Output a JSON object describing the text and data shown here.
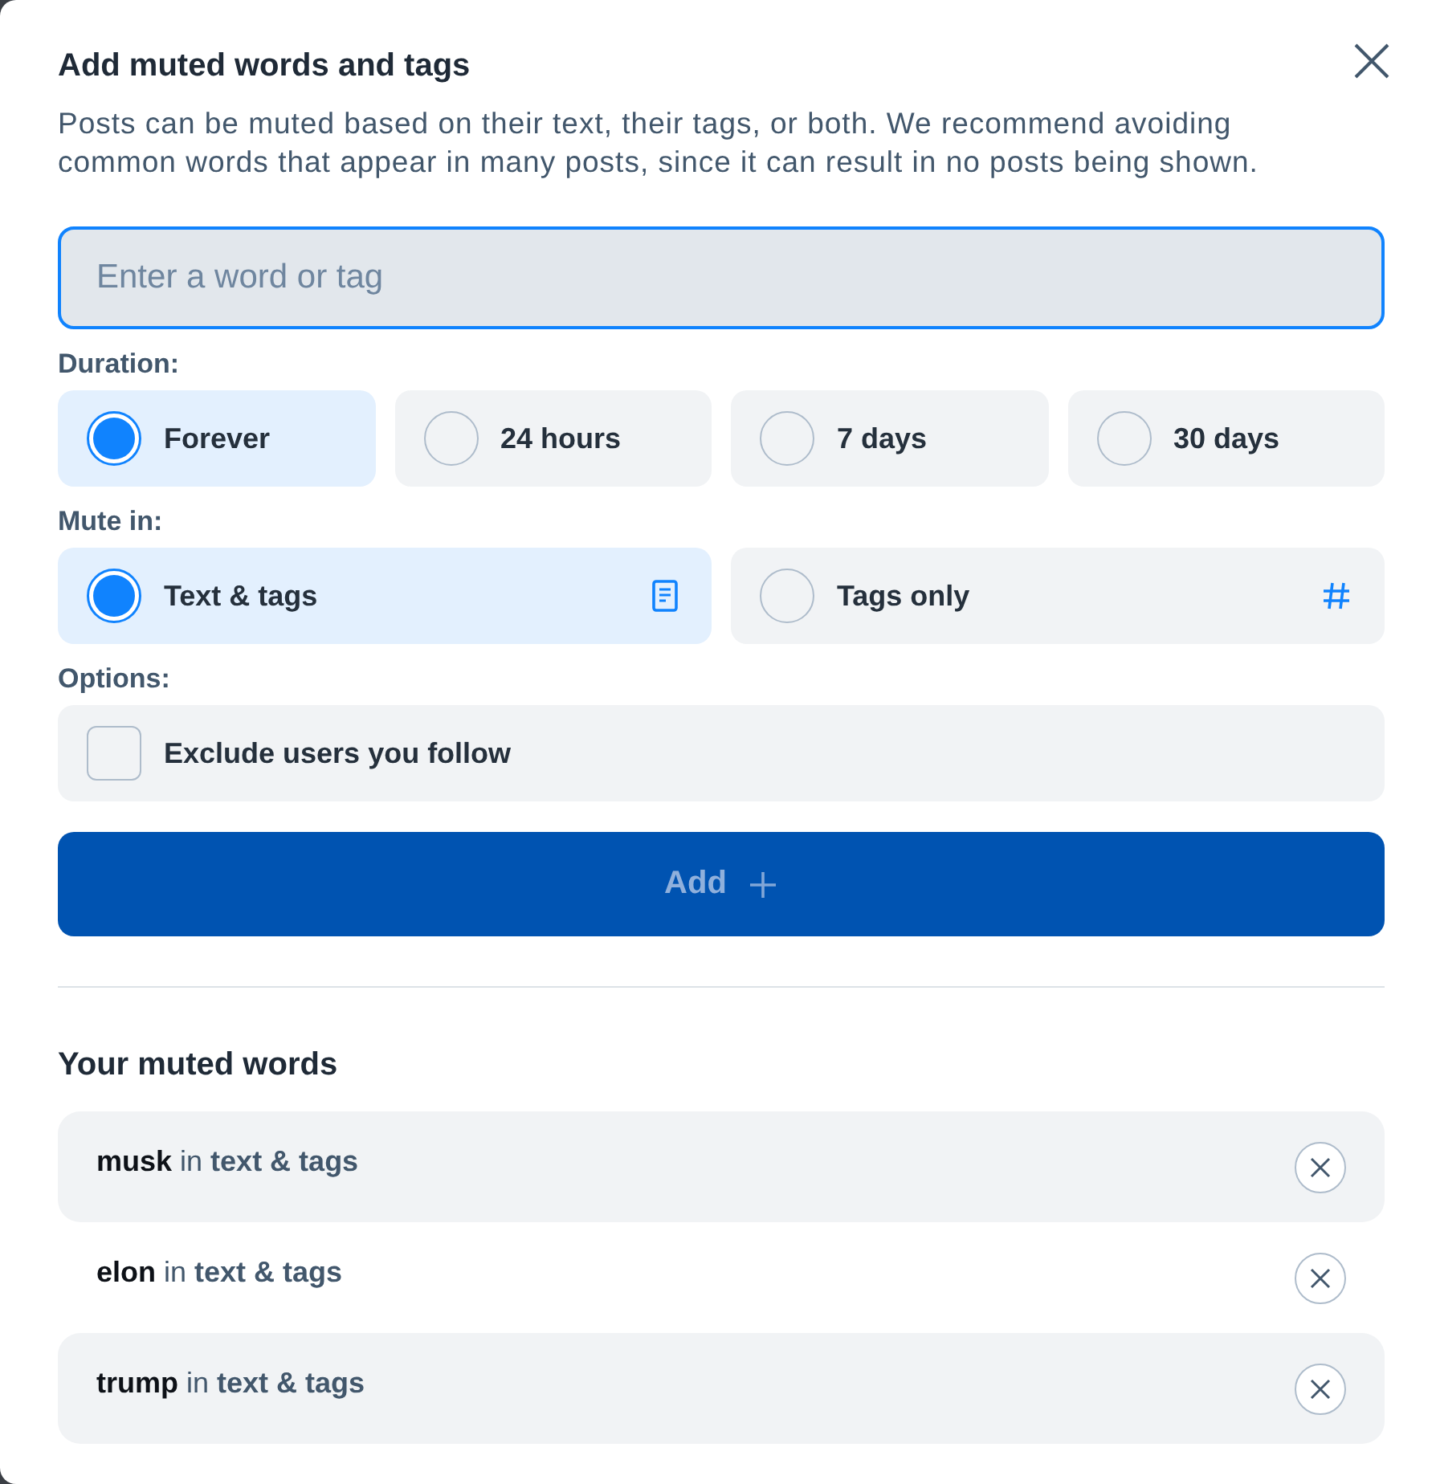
{
  "dialog": {
    "title": "Add muted words and tags",
    "description": "Posts can be muted based on their text, their tags, or both. We recommend avoiding common words that appear in many posts, since it can result in no posts being shown."
  },
  "input": {
    "placeholder": "Enter a word or tag",
    "focused": true
  },
  "duration": {
    "label": "Duration:",
    "options": [
      {
        "label": "Forever",
        "selected": true
      },
      {
        "label": "24 hours",
        "selected": false
      },
      {
        "label": "7 days",
        "selected": false
      },
      {
        "label": "30 days",
        "selected": false
      }
    ]
  },
  "mute_in": {
    "label": "Mute in:",
    "options": [
      {
        "label": "Text & tags",
        "selected": true
      },
      {
        "label": "Tags only",
        "selected": false
      }
    ]
  },
  "options": {
    "label": "Options:",
    "items": [
      {
        "label": "Exclude users you follow",
        "checked": false
      }
    ]
  },
  "add_button": {
    "label": "Add",
    "disabled": true
  },
  "muted_words": {
    "title": "Your muted words",
    "items": [
      {
        "text": "**musk** in **text & tags**"
      },
      {
        "text": "**elon** in **text & tags**"
      },
      {
        "text": "**trump** in **text & tags**"
      }
    ]
  }
}
